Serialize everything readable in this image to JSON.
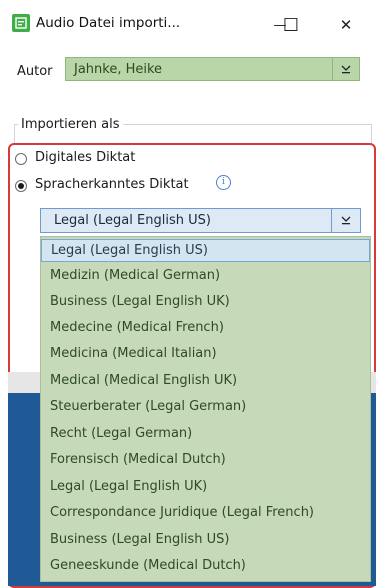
{
  "window": {
    "title": "Audio Datei importi...",
    "minimize_glyph": "—",
    "maximize_glyph": "☐",
    "close_glyph": "✕"
  },
  "autor": {
    "label": "Autor",
    "value": "Jahnke, Heike"
  },
  "group": {
    "label": "Importieren als"
  },
  "options": {
    "digital": "Digitales Diktat",
    "speech": "Spracherkanntes Diktat"
  },
  "dropdown": {
    "selected": "Legal (Legal English US)",
    "items": [
      "Legal (Legal English US)",
      "Medizin (Medical German)",
      "Business (Legal English UK)",
      "Medecine (Medical French)",
      "Medicina (Medical Italian)",
      "Medical (Medical English UK)",
      "Steuerberater (Legal German)",
      "Recht (Legal German)",
      "Forensisch (Medical Dutch)",
      "Legal (Legal English UK)",
      "Correspondance Juridique (Legal French)",
      "Business (Legal English US)",
      "Geneeskunde (Medical Dutch)"
    ]
  },
  "colors": {
    "accent_red": "#d63b3b",
    "list_green": "#c6d9b8",
    "select_blue": "#ddeaf6",
    "app_icon": "#3fae49"
  },
  "icons": [
    "app-icon",
    "minimize-icon",
    "maximize-icon",
    "close-icon",
    "chevron-down-icon",
    "info-icon"
  ]
}
